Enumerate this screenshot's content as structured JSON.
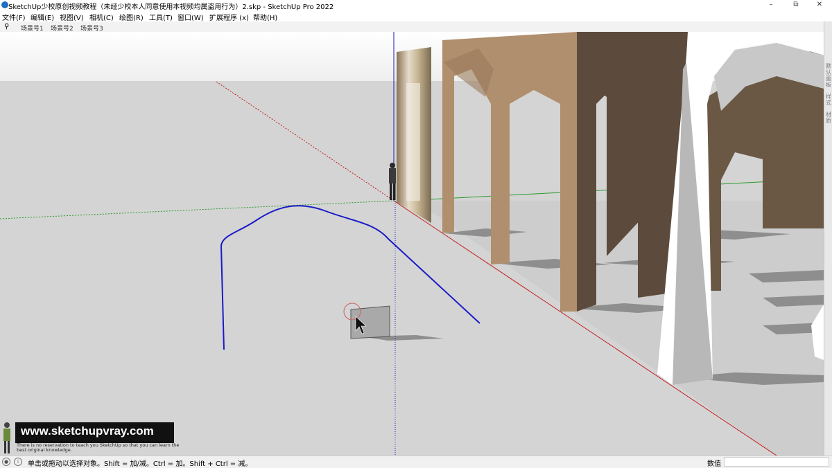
{
  "window": {
    "title": "SketchUp少校原创视频教程（未经少校本人同意使用本视频均属盗用行为）2.skp - SketchUp Pro 2022",
    "minimize": "–",
    "maximize": "⧉",
    "close": "✕"
  },
  "menu": [
    "文件(F)",
    "编辑(E)",
    "视图(V)",
    "相机(C)",
    "绘图(R)",
    "工具(T)",
    "窗口(W)",
    "扩展程序 (x)",
    "帮助(H)"
  ],
  "scenes": [
    "场景号1",
    "场景号2",
    "场景号3"
  ],
  "right_panel_tabs": [
    "默认面板",
    "样式",
    "材质"
  ],
  "watermark": {
    "url": "www.sketchupvray.com",
    "tagline": "There is no reservation to teach you SketchUp so that you can learn the best original knowledge."
  },
  "status": {
    "text": "单击或拖动以选择对象。Shift = 加/减。Ctrl = 加。Shift + Ctrl = 减。",
    "measurements_label": "数值",
    "measurements_value": ""
  },
  "colors": {
    "sky": "#f5f5f5",
    "ground": "#d4d4d4",
    "arch_wall": "#b08f6e",
    "arch_wall_dark": "#5c4b3c",
    "path_curve": "#1a1ac8",
    "red_axis": "#c41818",
    "green_axis": "#2a9a2a",
    "blue_axis": "#1a1ab0"
  }
}
